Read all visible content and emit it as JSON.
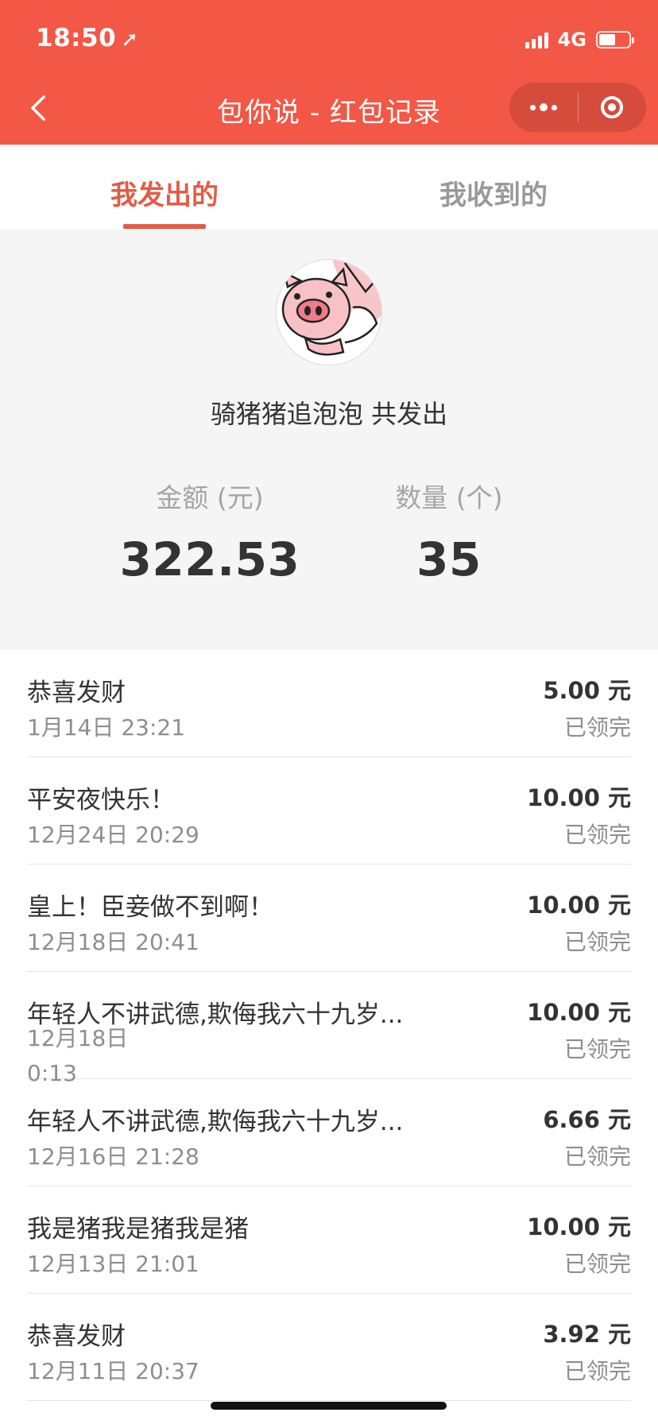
{
  "status_bar": {
    "time": "18:50",
    "network": "4G"
  },
  "nav": {
    "title": "包你说 - 红包记录"
  },
  "tabs": [
    {
      "label": "我发出的",
      "active": true
    },
    {
      "label": "我收到的",
      "active": false
    }
  ],
  "summary": {
    "name_line": "骑猪猪追泡泡 共发出",
    "amount_label": "金额 (元)",
    "amount_value": "322.53",
    "count_label": "数量 (个)",
    "count_value": "35"
  },
  "records": [
    {
      "title": "恭喜发财",
      "time": "1月14日 23:21",
      "amount": "5.00 元",
      "status": "已领完"
    },
    {
      "title": "平安夜快乐！",
      "time": "12月24日 20:29",
      "amount": "10.00 元",
      "status": "已领完"
    },
    {
      "title": "皇上！臣妾做不到啊！",
      "time": "12月18日 20:41",
      "amount": "10.00 元",
      "status": "已领完"
    },
    {
      "title": "年轻人不讲武德,欺侮我六十九岁...",
      "time": "12月18日 0:13",
      "amount": "10.00 元",
      "status": "已领完"
    },
    {
      "title": "年轻人不讲武德,欺侮我六十九岁...",
      "time": "12月16日 21:28",
      "amount": "6.66 元",
      "status": "已领完"
    },
    {
      "title": "我是猪我是猪我是猪",
      "time": "12月13日 21:01",
      "amount": "10.00 元",
      "status": "已领完"
    },
    {
      "title": "恭喜发财",
      "time": "12月11日 20:37",
      "amount": "3.92 元",
      "status": "已领完"
    }
  ],
  "colors": {
    "header": "#f35745",
    "accent": "#e45b45",
    "summary_bg": "#f5f5f5"
  }
}
